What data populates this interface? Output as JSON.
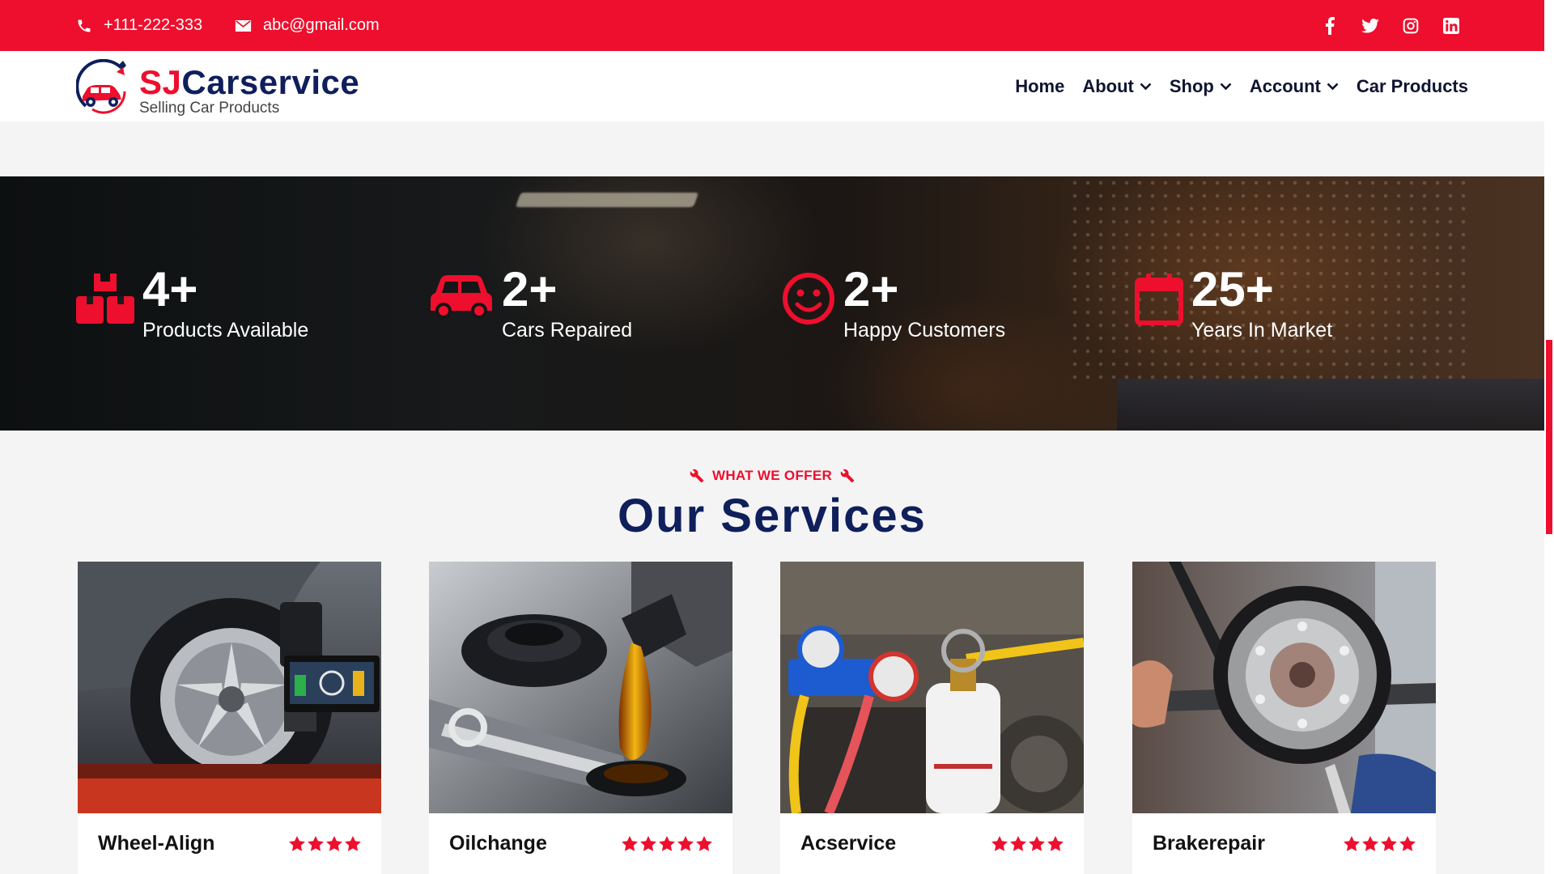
{
  "topbar": {
    "phone": "+111-222-333",
    "email": "abc@gmail.com",
    "social": [
      "facebook-icon",
      "twitter-icon",
      "instagram-icon",
      "linkedin-icon"
    ]
  },
  "brand": {
    "sj": "SJ",
    "name": "Carservice",
    "tagline": "Selling Car Products"
  },
  "nav": {
    "home": "Home",
    "about": "About",
    "shop": "Shop",
    "account": "Account",
    "car_products": "Car Products"
  },
  "stats": [
    {
      "value": "4+",
      "label": "Products Available",
      "icon": "boxes-icon"
    },
    {
      "value": "2+",
      "label": "Cars Repaired",
      "icon": "car-icon"
    },
    {
      "value": "2+",
      "label": "Happy Customers",
      "icon": "smiley-icon"
    },
    {
      "value": "25+",
      "label": "Years In Market",
      "icon": "calendar-icon"
    }
  ],
  "services": {
    "subtitle": "WHAT WE OFFER",
    "title": "Our Services",
    "cards": [
      {
        "name": "Wheel-Align",
        "rating": 4
      },
      {
        "name": "Oilchange",
        "rating": 5
      },
      {
        "name": "Acservice",
        "rating": 4
      },
      {
        "name": "Brakerepair",
        "rating": 4
      }
    ]
  },
  "colors": {
    "accent": "#ed0f2d",
    "navy": "#0f1f5c"
  }
}
